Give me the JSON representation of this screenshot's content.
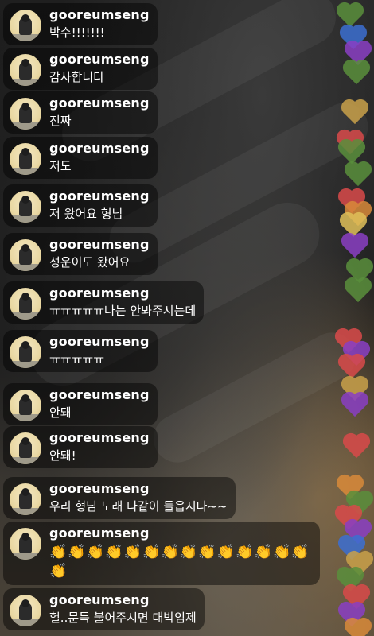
{
  "comments": [
    {
      "username": "gooreumseng",
      "message": "박수!!!!!!!"
    },
    {
      "username": "gooreumseng",
      "message": "감사합니다"
    },
    {
      "username": "gooreumseng",
      "message": "진짜"
    },
    {
      "username": "gooreumseng",
      "message": "저도"
    },
    {
      "username": "gooreumseng",
      "message": "저 왔어요 형님"
    },
    {
      "username": "gooreumseng",
      "message": "성운이도 왔어요"
    },
    {
      "username": "gooreumseng",
      "message": "ㅠㅠㅠㅠㅠ나는 안봐주시는데"
    },
    {
      "username": "gooreumseng",
      "message": "ㅠㅠㅠㅠㅠ"
    },
    {
      "username": "gooreumseng",
      "message": "안돼"
    },
    {
      "username": "gooreumseng",
      "message": "안돼!"
    },
    {
      "username": "gooreumseng",
      "message": "우리 형님 노래 다같이 들읍시다~~"
    },
    {
      "username": "gooreumseng",
      "message": "👏👏👏👏👏👏👏👏👏👏👏👏👏👏👏"
    },
    {
      "username": "gooreumseng",
      "message": "헐..문득 불어주시면 대박임제"
    }
  ],
  "heart_colors": [
    "#5a8f3c",
    "#3c6fd1",
    "#8a3fc4",
    "#d94a4a",
    "#c9a14a",
    "#d98a3a",
    "#e0c05a"
  ]
}
